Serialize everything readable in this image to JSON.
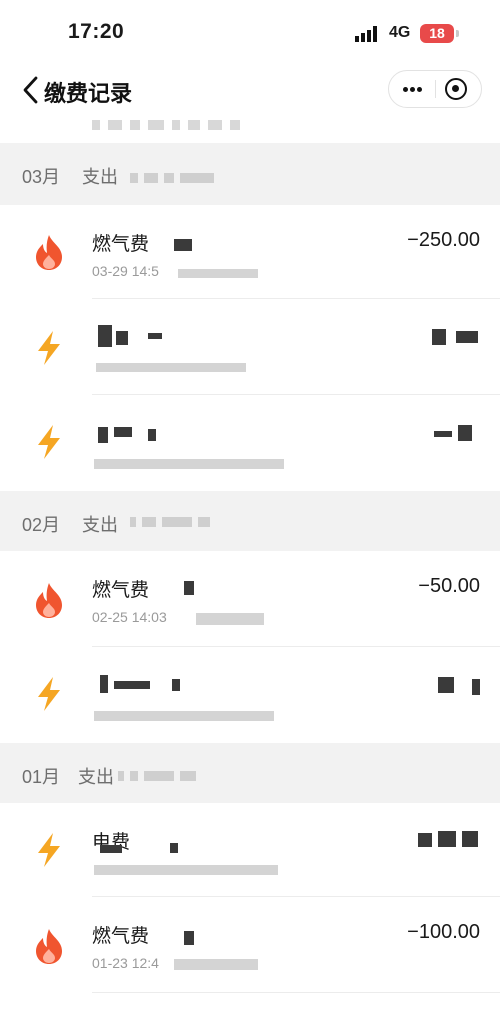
{
  "status_bar": {
    "time": "17:20",
    "network": "4G",
    "battery": "18"
  },
  "nav": {
    "title": "缴费记录"
  },
  "icons": {
    "back": "chevron-left-icon",
    "more": "more-dots-icon",
    "close": "target-close-icon",
    "gas": "flame-icon",
    "electricity": "lightning-icon"
  },
  "colors": {
    "gas_icon": "#f0552f",
    "electricity_icon": "#f5a623",
    "battery": "#e84a4a"
  },
  "sections": [
    {
      "month": "03月",
      "expense_label": "支出",
      "records": [
        {
          "type": "gas",
          "name": "燃气费",
          "date": "03-29 14:5",
          "amount": "−250.00"
        },
        {
          "type": "electricity",
          "name": "",
          "date": "",
          "amount": ""
        },
        {
          "type": "electricity",
          "name": "",
          "date": "",
          "amount": ""
        }
      ]
    },
    {
      "month": "02月",
      "expense_label": "支出",
      "records": [
        {
          "type": "gas",
          "name": "燃气费",
          "date": "02-25 14:03",
          "amount": "−50.00"
        },
        {
          "type": "electricity",
          "name": "",
          "date": "",
          "amount": ""
        }
      ]
    },
    {
      "month": "01月",
      "expense_label": "支出",
      "records": [
        {
          "type": "electricity",
          "name": "电费",
          "date": "",
          "amount": ""
        },
        {
          "type": "gas",
          "name": "燃气费",
          "date": "01-23 12:4",
          "amount": "−100.00"
        }
      ]
    }
  ]
}
